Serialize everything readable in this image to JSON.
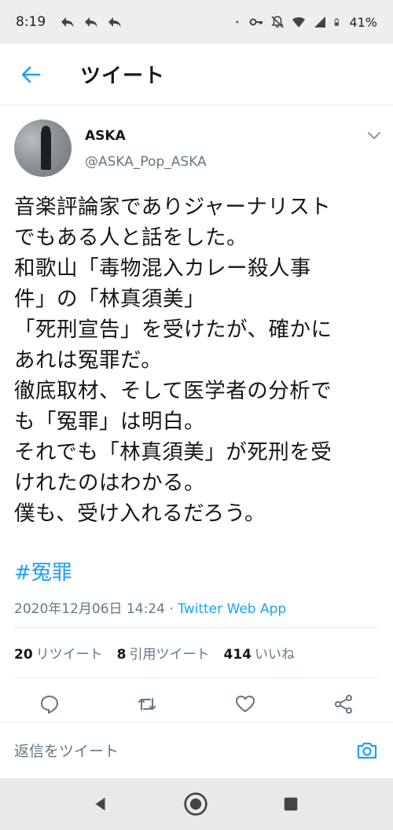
{
  "status_bar": {
    "time": "8:19",
    "battery": "41%",
    "left_icons": [
      "reply-arrow-icon",
      "reply-arrow-icon",
      "reply-arrow-icon"
    ],
    "right_icons": [
      "dot-icon",
      "key-icon",
      "bell-off-icon",
      "wifi-icon",
      "signal-icon",
      "battery-icon"
    ]
  },
  "header": {
    "title": "ツイート"
  },
  "tweet": {
    "name": "ASKA",
    "handle": "@ASKA_Pop_ASKA",
    "text": "音楽評論家でありジャーナリスト\nでもある人と話をした。\n和歌山「毒物混入カレー殺人事\n件」の「林真須美」\n「死刑宣告」を受けたが、確かに\nあれは冤罪だ。\n徹底取材、そして医学者の分析で\nも「冤罪」は明白。\nそれでも「林真須美」が死刑を受\nけれたのはわかる。\n僕も、受け入れるだろう。",
    "hashtag": "#冤罪",
    "timestamp": "2020年12月06日 14:24",
    "separator": "·",
    "via": "Twitter Web App"
  },
  "stats": {
    "retweets_count": "20",
    "retweets_label": "リツイート",
    "quotes_count": "8",
    "quotes_label": "引用ツイート",
    "likes_count": "414",
    "likes_label": "いいね"
  },
  "reply": {
    "placeholder": "返信をツイート"
  },
  "colors": {
    "accent": "#1da1f2",
    "secondary_text": "#657786",
    "divider": "#e6ecf0"
  }
}
